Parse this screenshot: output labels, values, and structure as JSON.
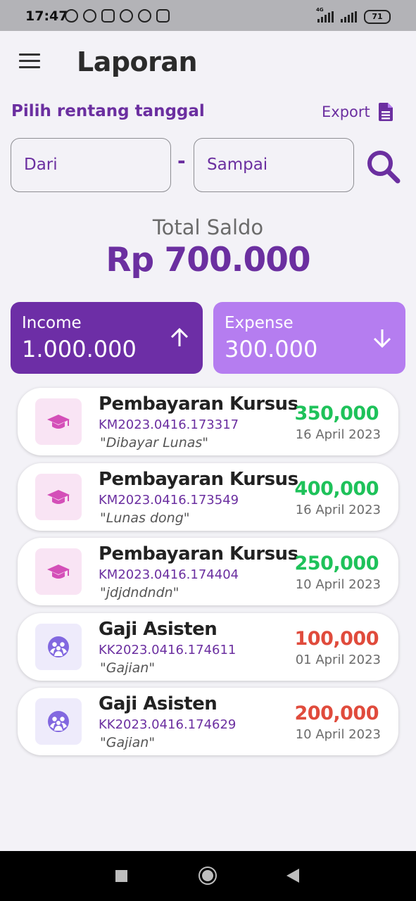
{
  "status_bar": {
    "time": "17:47",
    "network_type": "4G",
    "battery_level": "71"
  },
  "header": {
    "title": "Laporan",
    "menu_icon": "hamburger-menu-icon"
  },
  "filter": {
    "label": "Pilih rentang tanggal",
    "export_label": "Export",
    "export_icon": "document-icon",
    "from_placeholder": "Dari",
    "separator": "-",
    "to_placeholder": "Sampai",
    "search_icon": "search-icon"
  },
  "summary": {
    "total_label": "Total Saldo",
    "total_value": "Rp 700.000",
    "income_label": "Income",
    "income_value": "1.000.000",
    "expense_label": "Expense",
    "expense_value": "300.000"
  },
  "colors": {
    "primary": "#6b2fa0",
    "income_card": "#6d2ea6",
    "expense_card": "#b57df0",
    "income_amount": "#1ec25a",
    "expense_amount": "#e04b3c"
  },
  "transactions": [
    {
      "title": "Pembayaran Kursus",
      "code": "KM2023.0416.173317",
      "note": "\"Dibayar Lunas\"",
      "amount": "350,000",
      "date": "16 April 2023",
      "type": "income",
      "icon": "graduation-cap-icon"
    },
    {
      "title": "Pembayaran Kursus",
      "code": "KM2023.0416.173549",
      "note": "\"Lunas dong\"",
      "amount": "400,000",
      "date": "16 April 2023",
      "type": "income",
      "icon": "graduation-cap-icon"
    },
    {
      "title": "Pembayaran Kursus",
      "code": "KM2023.0416.174404",
      "note": "\"jdjdndndn\"",
      "amount": "250,000",
      "date": "10 April 2023",
      "type": "income",
      "icon": "graduation-cap-icon"
    },
    {
      "title": "Gaji Asisten",
      "code": "KK2023.0416.174611",
      "note": "\"Gajian\"",
      "amount": "100,000",
      "date": "01 April 2023",
      "type": "expense",
      "icon": "people-icon"
    },
    {
      "title": "Gaji Asisten",
      "code": "KK2023.0416.174629",
      "note": "\"Gajian\"",
      "amount": "200,000",
      "date": "10 April 2023",
      "type": "expense",
      "icon": "people-icon"
    }
  ]
}
